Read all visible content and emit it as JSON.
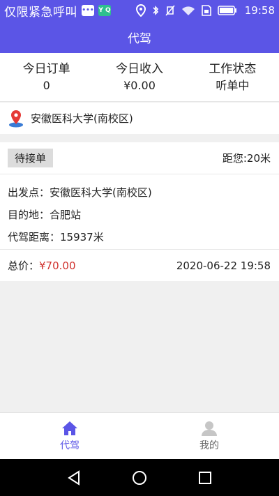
{
  "status_bar": {
    "carrier": "仅限紧急呼叫",
    "message_icon": "chat-bubble-icon",
    "app_icon_text": "Y Q",
    "time": "19:58"
  },
  "app_bar": {
    "title": "代驾"
  },
  "stats": [
    {
      "label": "今日订单",
      "value": "0"
    },
    {
      "label": "今日收入",
      "value": "¥0.00"
    },
    {
      "label": "工作状态",
      "value": "听单中"
    }
  ],
  "location": {
    "text": "安徽医科大学(南校区)",
    "icon": "location-pin-icon"
  },
  "order": {
    "status": "待接单",
    "distance": "距您:20米",
    "origin": "出发点：安徽医科大学(南校区)",
    "destination": "目的地：合肥站",
    "drive_distance": "代驾距离：15937米",
    "price_label": "总价：",
    "price_value": "¥70.00",
    "time": "2020-06-22 19:58"
  },
  "tabs": [
    {
      "label": "代驾",
      "icon": "home-icon",
      "active": true
    },
    {
      "label": "我的",
      "icon": "user-icon",
      "active": false
    }
  ],
  "colors": {
    "primary": "#5b55e6",
    "price": "#d0312d",
    "background": "#f0f0f0"
  }
}
